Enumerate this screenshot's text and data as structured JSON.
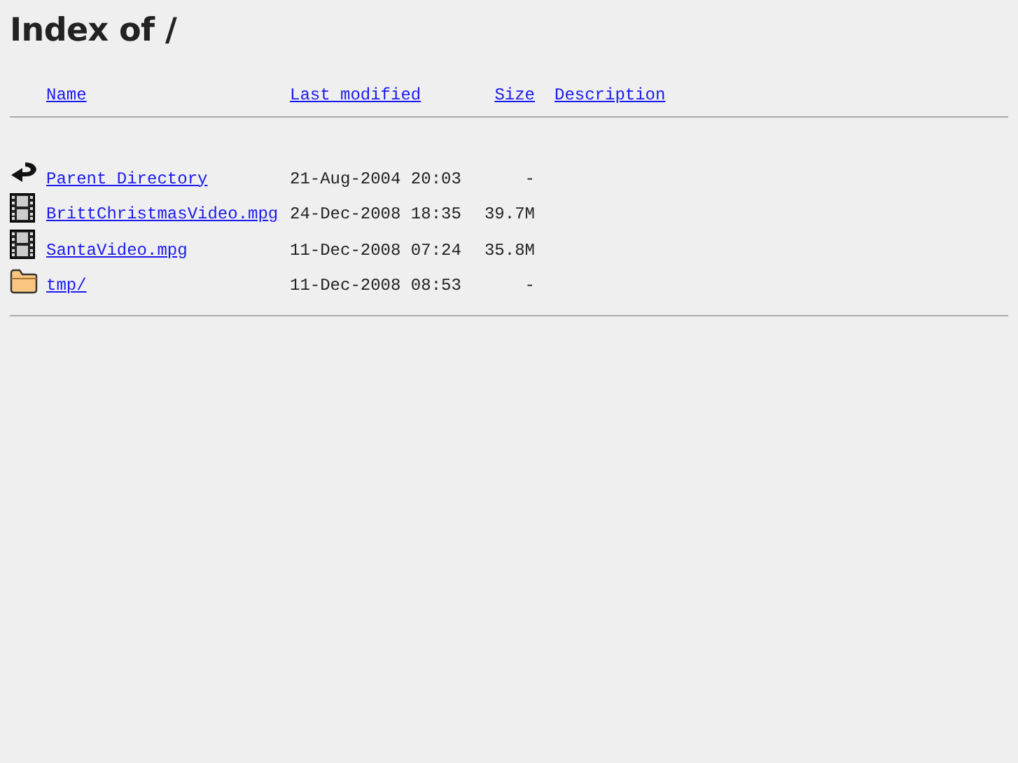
{
  "title": "Index of /",
  "columns": [
    "Name",
    "Last modified",
    "Size",
    "Description"
  ],
  "rows": [
    {
      "kind": "back",
      "name": "Parent Directory",
      "modified": "21-Aug-2004 20:03",
      "size": "-"
    },
    {
      "kind": "video",
      "name": "BrittChristmasVideo.mpg",
      "modified": "24-Dec-2008 18:35",
      "size": "39.7M"
    },
    {
      "kind": "video",
      "name": "SantaVideo.mpg",
      "modified": "11-Dec-2008 07:24",
      "size": "35.8M"
    },
    {
      "kind": "folder",
      "name": "tmp/",
      "modified": "11-Dec-2008 08:53",
      "size": "-"
    }
  ]
}
